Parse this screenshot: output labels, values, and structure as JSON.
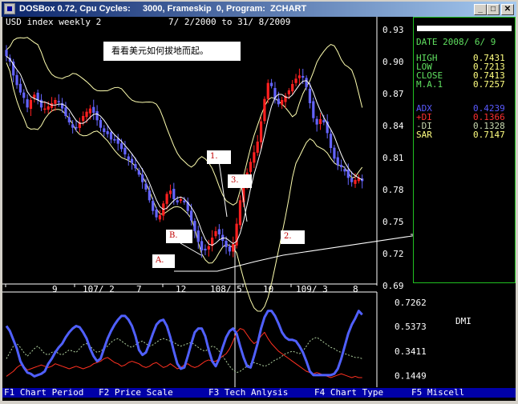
{
  "window": {
    "title": "DOSBox 0.72, Cpu Cycles:     3000, Frameskip  0, Program:  ZCHART",
    "buttons": {
      "minimize": "_",
      "maximize": "□",
      "close": "✕"
    }
  },
  "chart": {
    "header_left": "USD  index weekly 2",
    "header_range": "7/ 2/2000  to 31/ 8/2009",
    "annotation": "看看美元如何拔地而起。",
    "labels": {
      "one": "1.",
      "three": "3.",
      "b": "B.",
      "a": "A.",
      "two": "2."
    }
  },
  "info": {
    "date": "DATE 2008/ 6/ 9",
    "rows1": [
      {
        "k": "HIGH",
        "v": "0.7431"
      },
      {
        "k": "LOW",
        "v": "0.7213"
      },
      {
        "k": "CLOSE",
        "v": "0.7413"
      },
      {
        "k": "M.A.1",
        "v": "0.7257"
      }
    ],
    "rows2": [
      {
        "k": "ADX",
        "v": "0.4239",
        "color": "#5a5aff"
      },
      {
        "k": "+DI",
        "v": "0.1366",
        "color": "#ff3030"
      },
      {
        "k": "-DI",
        "v": "0.1328",
        "color": "#c8d8b0"
      },
      {
        "k": "SAR",
        "v": "0.7147",
        "color": "#ffff80"
      }
    ]
  },
  "fkeys": [
    "F1 Chart Period",
    "F2 Price Scale",
    "F3 Tech Anlysis",
    "F4 Chart Type",
    "F5 Miscell"
  ],
  "colors": {
    "bull": "#ff2020",
    "bear": "#6464ff",
    "adx": "#5060ff",
    "plus_di": "#ff3020",
    "minus_di": "#b0d0a0",
    "info_label": "#60e060",
    "sar": "#ffff80",
    "frame": "#20c020"
  },
  "chart_data": [
    {
      "type": "candlestick",
      "title": "USD  index weekly 2",
      "subtitle": "7/ 2/2000  to 31/ 8/2009",
      "y_ticks": [
        0.93,
        0.9,
        0.87,
        0.84,
        0.81,
        0.78,
        0.75,
        0.72,
        0.69
      ],
      "ylim": [
        0.69,
        0.93
      ],
      "x_ticks": [
        "9",
        "107/ 2",
        "7",
        "12",
        "108/ 5",
        "10",
        "109/ 3",
        "8"
      ],
      "close": [
        0.905,
        0.9,
        0.887,
        0.878,
        0.871,
        0.866,
        0.857,
        0.864,
        0.869,
        0.864,
        0.857,
        0.856,
        0.858,
        0.861,
        0.864,
        0.862,
        0.856,
        0.849,
        0.843,
        0.838,
        0.838,
        0.843,
        0.849,
        0.853,
        0.856,
        0.852,
        0.845,
        0.838,
        0.834,
        0.832,
        0.827,
        0.826,
        0.823,
        0.818,
        0.813,
        0.808,
        0.805,
        0.8,
        0.794,
        0.787,
        0.78,
        0.77,
        0.76,
        0.754,
        0.756,
        0.767,
        0.776,
        0.779,
        0.771,
        0.768,
        0.771,
        0.768,
        0.76,
        0.751,
        0.741,
        0.731,
        0.723,
        0.723,
        0.727,
        0.735,
        0.741,
        0.738,
        0.732,
        0.726,
        0.722,
        0.729,
        0.748,
        0.77,
        0.785,
        0.796,
        0.806,
        0.815,
        0.825,
        0.844,
        0.865,
        0.88,
        0.877,
        0.865,
        0.86,
        0.864,
        0.868,
        0.873,
        0.879,
        0.884,
        0.887,
        0.885,
        0.876,
        0.861,
        0.847,
        0.841,
        0.846,
        0.843,
        0.833,
        0.819,
        0.809,
        0.803,
        0.801,
        0.797,
        0.791,
        0.787,
        0.789,
        0.791,
        0.788
      ]
    },
    {
      "type": "line",
      "title": "DMI",
      "y_ticks": [
        0.7262,
        0.5373,
        0.3411,
        0.1449
      ],
      "ylim": [
        0.06,
        0.81
      ],
      "series": [
        {
          "name": "ADX",
          "values": [
            0.54,
            0.5,
            0.43,
            0.36,
            0.26,
            0.21,
            0.17,
            0.16,
            0.14,
            0.15,
            0.16,
            0.18,
            0.24,
            0.28,
            0.33,
            0.37,
            0.4,
            0.45,
            0.49,
            0.52,
            0.54,
            0.53,
            0.49,
            0.44,
            0.36,
            0.3,
            0.26,
            0.28,
            0.36,
            0.44,
            0.5,
            0.55,
            0.59,
            0.62,
            0.62,
            0.59,
            0.54,
            0.46,
            0.35,
            0.31,
            0.33,
            0.4,
            0.48,
            0.55,
            0.58,
            0.59,
            0.54,
            0.45,
            0.34,
            0.24,
            0.2,
            0.21,
            0.3,
            0.4,
            0.49,
            0.52,
            0.52,
            0.46,
            0.35,
            0.26,
            0.22,
            0.28,
            0.37,
            0.45,
            0.5,
            0.52,
            0.48,
            0.38,
            0.29,
            0.22,
            0.21,
            0.3,
            0.4,
            0.52,
            0.61,
            0.66,
            0.66,
            0.62,
            0.56,
            0.49,
            0.45,
            0.43,
            0.43,
            0.42,
            0.38,
            0.33,
            0.26,
            0.18,
            0.15,
            0.15,
            0.15,
            0.15,
            0.15,
            0.15,
            0.16,
            0.2,
            0.28,
            0.38,
            0.48,
            0.55,
            0.6,
            0.66,
            0.63
          ]
        },
        {
          "name": "+DI",
          "values": [
            0.14,
            0.16,
            0.18,
            0.21,
            0.23,
            0.22,
            0.19,
            0.2,
            0.21,
            0.22,
            0.23,
            0.22,
            0.21,
            0.22,
            0.24,
            0.23,
            0.22,
            0.21,
            0.2,
            0.21,
            0.22,
            0.21,
            0.2,
            0.21,
            0.22,
            0.24,
            0.25,
            0.26,
            0.28,
            0.29,
            0.27,
            0.25,
            0.24,
            0.22,
            0.23,
            0.25,
            0.26,
            0.25,
            0.24,
            0.22,
            0.21,
            0.22,
            0.24,
            0.25,
            0.23,
            0.21,
            0.22,
            0.24,
            0.22,
            0.2,
            0.21,
            0.23,
            0.24,
            0.22,
            0.21,
            0.22,
            0.24,
            0.26,
            0.27,
            0.26,
            0.26,
            0.28,
            0.3,
            0.32,
            0.36,
            0.42,
            0.49,
            0.52,
            0.51,
            0.47,
            0.43,
            0.4,
            0.42,
            0.46,
            0.49,
            0.44,
            0.4,
            0.37,
            0.34,
            0.32,
            0.3,
            0.28,
            0.26,
            0.24,
            0.22,
            0.2,
            0.18,
            0.17,
            0.16,
            0.17,
            0.16,
            0.15,
            0.14,
            0.13,
            0.14,
            0.15,
            0.16,
            0.15,
            0.14,
            0.13,
            0.14,
            0.13,
            0.13
          ]
        },
        {
          "name": "-DI",
          "values": [
            0.28,
            0.33,
            0.38,
            0.4,
            0.37,
            0.33,
            0.3,
            0.33,
            0.36,
            0.38,
            0.35,
            0.32,
            0.31,
            0.33,
            0.34,
            0.32,
            0.31,
            0.33,
            0.35,
            0.34,
            0.33,
            0.36,
            0.39,
            0.4,
            0.38,
            0.35,
            0.33,
            0.34,
            0.36,
            0.38,
            0.41,
            0.43,
            0.44,
            0.42,
            0.4,
            0.38,
            0.37,
            0.39,
            0.41,
            0.42,
            0.4,
            0.38,
            0.39,
            0.41,
            0.43,
            0.44,
            0.43,
            0.42,
            0.41,
            0.39,
            0.38,
            0.39,
            0.4,
            0.41,
            0.39,
            0.37,
            0.35,
            0.34,
            0.36,
            0.38,
            0.37,
            0.34,
            0.3,
            0.26,
            0.22,
            0.19,
            0.17,
            0.18,
            0.2,
            0.22,
            0.24,
            0.25,
            0.24,
            0.23,
            0.22,
            0.23,
            0.25,
            0.27,
            0.28,
            0.3,
            0.32,
            0.33,
            0.34,
            0.33,
            0.32,
            0.34,
            0.38,
            0.42,
            0.44,
            0.45,
            0.43,
            0.41,
            0.39,
            0.37,
            0.36,
            0.34,
            0.33,
            0.32,
            0.31,
            0.3,
            0.29,
            0.29,
            0.28
          ]
        }
      ]
    }
  ]
}
